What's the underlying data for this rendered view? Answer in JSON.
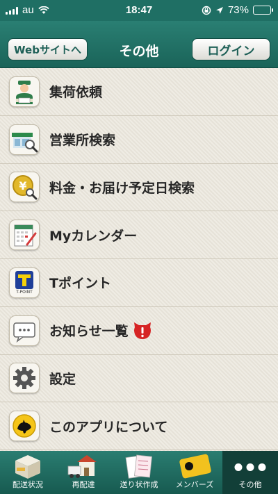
{
  "status": {
    "carrier": "au",
    "time": "18:47",
    "battery": "73%",
    "battery_level": 0.73
  },
  "nav": {
    "web_label": "Webサイトへ",
    "title": "その他",
    "login_label": "ログイン"
  },
  "menu": [
    {
      "label": "集荷依頼",
      "icon": "courier-icon"
    },
    {
      "label": "営業所検索",
      "icon": "office-search-icon"
    },
    {
      "label": "料金・お届け予定日検索",
      "icon": "yen-search-icon"
    },
    {
      "label": "Myカレンダー",
      "icon": "calendar-icon"
    },
    {
      "label": "Tポイント",
      "icon": "tpoint-icon"
    },
    {
      "label": "お知らせ一覧",
      "icon": "message-icon"
    },
    {
      "label": "設定",
      "icon": "gear-icon"
    },
    {
      "label": "このアプリについて",
      "icon": "black-cat-icon"
    }
  ],
  "tpoint_caption": "T-POINT",
  "tabs": [
    {
      "label": "配送状況",
      "icon": "package-icon"
    },
    {
      "label": "再配達",
      "icon": "truck-house-icon"
    },
    {
      "label": "送り状作成",
      "icon": "invoice-icon"
    },
    {
      "label": "メンバーズ",
      "icon": "members-card-icon"
    },
    {
      "label": "その他",
      "icon": "more-dots-icon",
      "active": true
    }
  ]
}
